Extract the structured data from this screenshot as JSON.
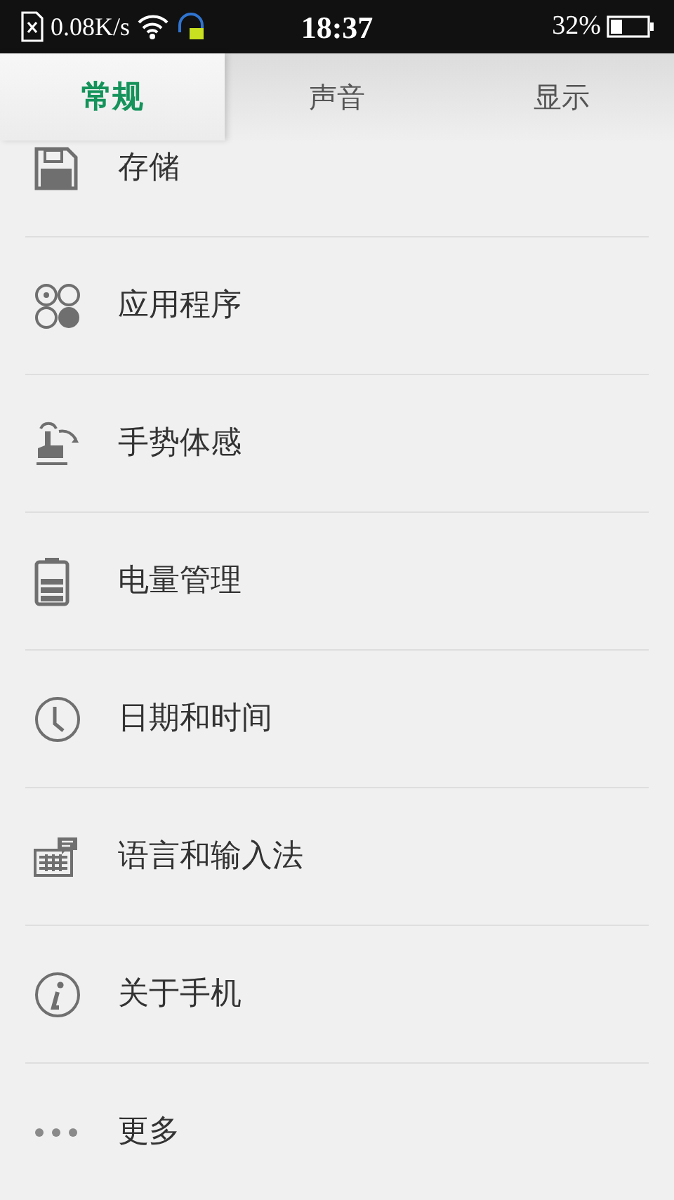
{
  "status_bar": {
    "speed": "0.08K/s",
    "time": "18:37",
    "battery": "32%"
  },
  "tabs": [
    {
      "label": "常规",
      "selected": true
    },
    {
      "label": "声音",
      "selected": false
    },
    {
      "label": "显示",
      "selected": false
    }
  ],
  "items": [
    {
      "label": "存储"
    },
    {
      "label": "应用程序"
    },
    {
      "label": "手势体感"
    },
    {
      "label": "电量管理"
    },
    {
      "label": "日期和时间"
    },
    {
      "label": "语言和输入法"
    },
    {
      "label": "关于手机"
    },
    {
      "label": "更多"
    }
  ]
}
